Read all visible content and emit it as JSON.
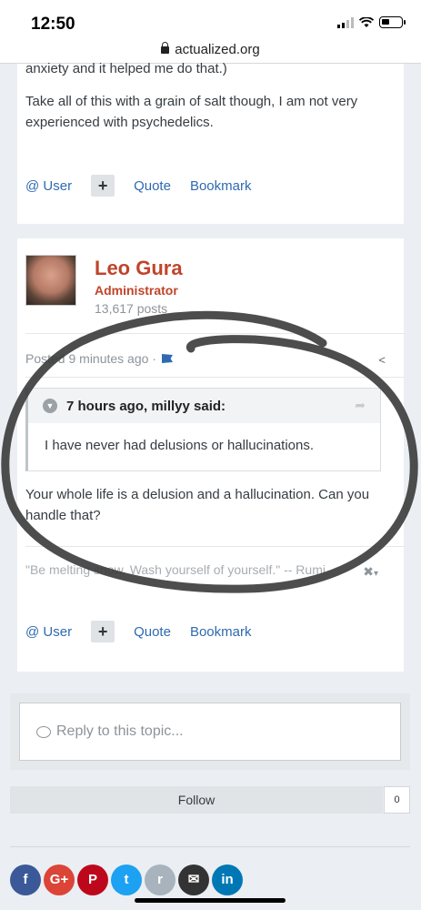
{
  "status": {
    "time": "12:50"
  },
  "browser": {
    "url": "actualized.org"
  },
  "post1": {
    "text_top": "anxiety and it helped me do that.)",
    "text_main": "Take all of this with a grain of salt though, I am not very experienced with psychedelics.",
    "controls": {
      "user": "@ User",
      "plus": "+",
      "quote": "Quote",
      "bookmark": "Bookmark"
    }
  },
  "post2": {
    "author": {
      "name": "Leo Gura",
      "role": "Administrator",
      "posts": "13,617 posts"
    },
    "meta": "Posted 9 minutes ago ·",
    "quote": {
      "header": "7 hours ago, millyy said:",
      "body": "I have never had delusions or hallucinations."
    },
    "reply": "Your whole life is a delusion and a hallucination. Can you handle that?",
    "signature": "\"Be melting snow. Wash yourself of yourself.\" -- Rumi",
    "controls": {
      "user": "@ User",
      "plus": "+",
      "quote": "Quote",
      "bookmark": "Bookmark"
    }
  },
  "reply_box": {
    "placeholder": "Reply to this topic..."
  },
  "follow": {
    "label": "Follow",
    "count": "0"
  },
  "social": [
    {
      "icon": "facebook-icon",
      "glyph": "f",
      "color": "#3b5998"
    },
    {
      "icon": "google-plus-icon",
      "glyph": "G+",
      "color": "#db4437"
    },
    {
      "icon": "pinterest-icon",
      "glyph": "P",
      "color": "#bd081c"
    },
    {
      "icon": "twitter-icon",
      "glyph": "t",
      "color": "#1da1f2"
    },
    {
      "icon": "reddit-icon",
      "glyph": "r",
      "color": "#a9b3bd"
    },
    {
      "icon": "email-icon",
      "glyph": "✉",
      "color": "#333333"
    },
    {
      "icon": "linkedin-icon",
      "glyph": "in",
      "color": "#0077b5"
    }
  ]
}
